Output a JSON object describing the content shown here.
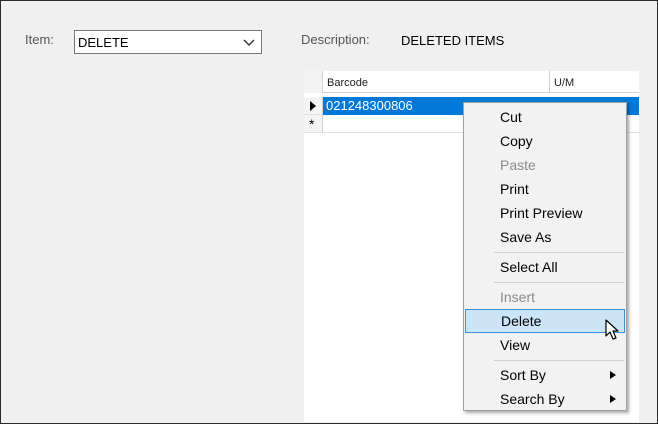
{
  "form": {
    "item_label": "Item:",
    "item_value": "DELETE",
    "description_label": "Description:",
    "description_value": "DELETED ITEMS"
  },
  "grid": {
    "columns": [
      "Barcode",
      "U/M"
    ],
    "rows": [
      {
        "barcode": "021248300806",
        "um": ""
      }
    ],
    "new_row_marker": "*"
  },
  "context_menu": {
    "items": [
      {
        "label": "Cut",
        "enabled": true
      },
      {
        "label": "Copy",
        "enabled": true
      },
      {
        "label": "Paste",
        "enabled": false
      },
      {
        "label": "Print",
        "enabled": true
      },
      {
        "label": "Print Preview",
        "enabled": true
      },
      {
        "label": "Save As",
        "enabled": true
      },
      {
        "label": "Select All",
        "enabled": true
      },
      {
        "label": "Insert",
        "enabled": false
      },
      {
        "label": "Delete",
        "enabled": true,
        "highlighted": true
      },
      {
        "label": "View",
        "enabled": true
      },
      {
        "label": "Sort By",
        "enabled": true,
        "has_submenu": true
      },
      {
        "label": "Search By",
        "enabled": true,
        "has_submenu": true
      }
    ]
  },
  "colors": {
    "selection": "#0078d7",
    "menu_highlight": "#cce4f7",
    "menu_highlight_border": "#3d8fd6",
    "disabled_text": "#8a8a8a"
  },
  "icons": [
    "chevron-down-icon",
    "row-indicator-icon",
    "submenu-arrow-icon",
    "mouse-cursor-icon"
  ]
}
